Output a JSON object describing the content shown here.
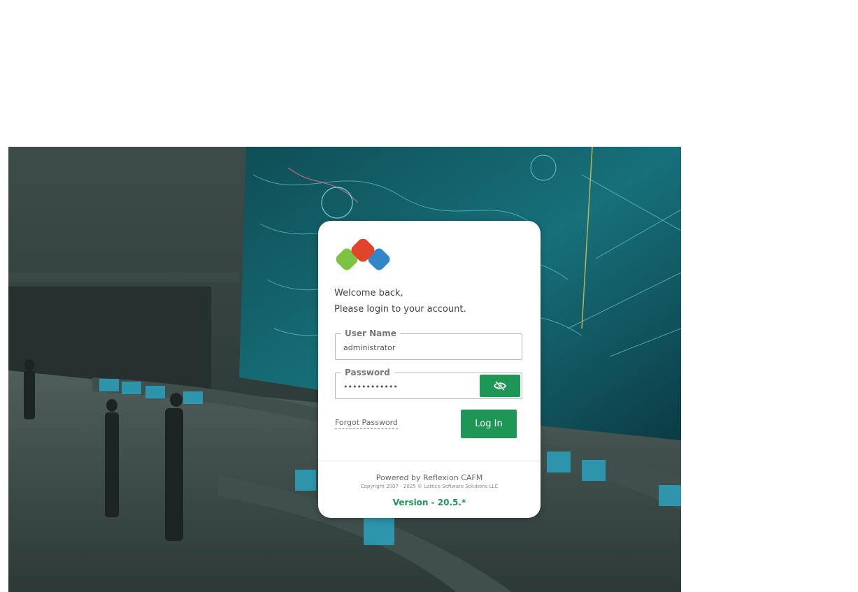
{
  "login": {
    "welcome_line1": "Welcome back,",
    "welcome_line2": "Please login to your account.",
    "username_label": "User Name",
    "username_value": "administrator",
    "password_label": "Password",
    "password_value": "••••••••••••",
    "toggle_visibility_icon": "eye-slash-icon",
    "forgot_password": "Forgot Password",
    "login_button": "Log In"
  },
  "footer": {
    "powered_by": "Powered by Reflexion CAFM",
    "copyright": "Copyright 2007 - 2025 © Lattice Software Solutions LLC",
    "version": "Version - 20.5.*"
  },
  "colors": {
    "accent": "#1e9655",
    "logo_green": "#7ec242",
    "logo_red": "#e0452b",
    "logo_blue": "#2f86c9"
  }
}
